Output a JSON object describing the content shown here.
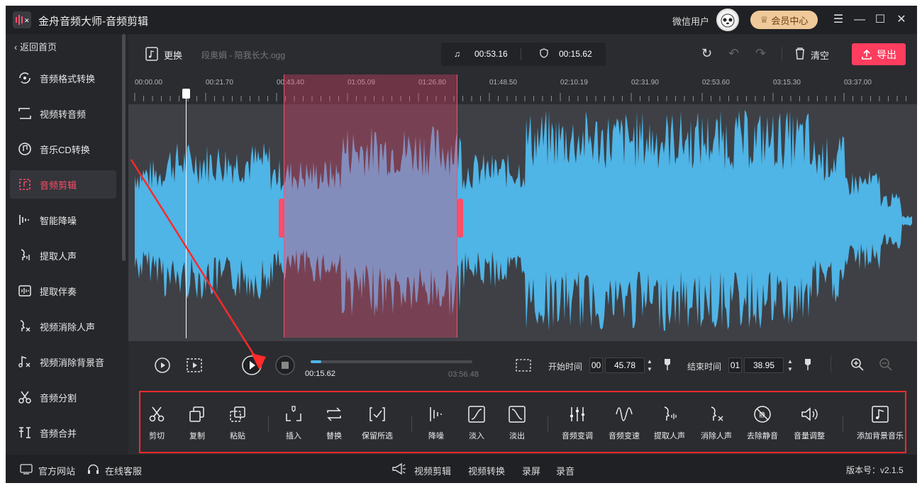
{
  "app": {
    "title": "金舟音频大师-音频剪辑",
    "user": "微信用户",
    "vip": "会员中心"
  },
  "sidebar": {
    "back": "返回首页",
    "items": [
      {
        "label": "音频格式转换"
      },
      {
        "label": "视频转音频"
      },
      {
        "label": "音乐CD转换"
      },
      {
        "label": "音频剪辑"
      },
      {
        "label": "智能降噪"
      },
      {
        "label": "提取人声"
      },
      {
        "label": "提取伴奏"
      },
      {
        "label": "视频消除人声"
      },
      {
        "label": "视频消除背景音"
      },
      {
        "label": "音频分割"
      },
      {
        "label": "音频合并"
      }
    ]
  },
  "toolbar": {
    "change": "更换",
    "filename": "段奥娟 - 陪我长大.ogg",
    "total_time": "00:53.16",
    "selected_time": "00:15.62",
    "clear": "清空",
    "export": "导出"
  },
  "ruler": [
    "00:00.00",
    "00:21.70",
    "00:43.40",
    "01:05.09",
    "01:26.80",
    "01:48.50",
    "02:10.19",
    "02:31.90",
    "02:53.60",
    "03:15.30",
    "03:37.00"
  ],
  "controls": {
    "current": "00:15.62",
    "duration": "03:56.48",
    "progress": 0.066,
    "start_label": "开始时间",
    "start_min": "00",
    "start_sec": "45.78",
    "end_label": "结束时间",
    "end_min": "01",
    "end_sec": "38.95"
  },
  "tools": [
    "剪切",
    "复制",
    "粘贴",
    "插入",
    "替换",
    "保留所选",
    "降噪",
    "淡入",
    "淡出",
    "音频变调",
    "音频变速",
    "提取人声",
    "消除人声",
    "去除静音",
    "音量调整",
    "添加背景音乐"
  ],
  "statusbar": {
    "website": "官方网站",
    "service": "在线客服",
    "links": [
      "视频剪辑",
      "视频转换",
      "录屏",
      "录音"
    ],
    "version": "版本号：v2.1.5"
  },
  "colors": {
    "accent": "#ff3d5e",
    "wave": "#4fb4e6",
    "selection": "#8a4a5a"
  }
}
